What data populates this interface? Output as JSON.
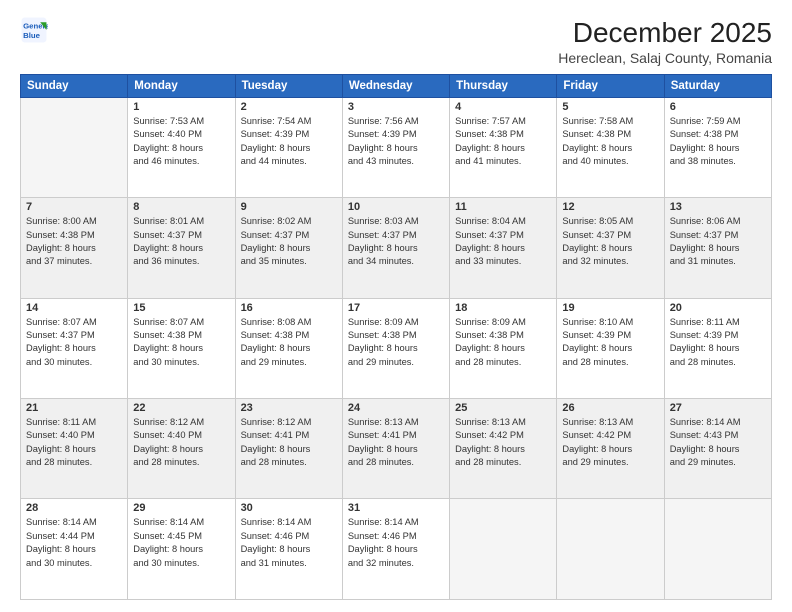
{
  "header": {
    "logo_line1": "General",
    "logo_line2": "Blue",
    "month": "December 2025",
    "location": "Hereclean, Salaj County, Romania"
  },
  "weekdays": [
    "Sunday",
    "Monday",
    "Tuesday",
    "Wednesday",
    "Thursday",
    "Friday",
    "Saturday"
  ],
  "weeks": [
    [
      {
        "day": "",
        "info": ""
      },
      {
        "day": "1",
        "info": "Sunrise: 7:53 AM\nSunset: 4:40 PM\nDaylight: 8 hours\nand 46 minutes."
      },
      {
        "day": "2",
        "info": "Sunrise: 7:54 AM\nSunset: 4:39 PM\nDaylight: 8 hours\nand 44 minutes."
      },
      {
        "day": "3",
        "info": "Sunrise: 7:56 AM\nSunset: 4:39 PM\nDaylight: 8 hours\nand 43 minutes."
      },
      {
        "day": "4",
        "info": "Sunrise: 7:57 AM\nSunset: 4:38 PM\nDaylight: 8 hours\nand 41 minutes."
      },
      {
        "day": "5",
        "info": "Sunrise: 7:58 AM\nSunset: 4:38 PM\nDaylight: 8 hours\nand 40 minutes."
      },
      {
        "day": "6",
        "info": "Sunrise: 7:59 AM\nSunset: 4:38 PM\nDaylight: 8 hours\nand 38 minutes."
      }
    ],
    [
      {
        "day": "7",
        "info": "Sunrise: 8:00 AM\nSunset: 4:38 PM\nDaylight: 8 hours\nand 37 minutes."
      },
      {
        "day": "8",
        "info": "Sunrise: 8:01 AM\nSunset: 4:37 PM\nDaylight: 8 hours\nand 36 minutes."
      },
      {
        "day": "9",
        "info": "Sunrise: 8:02 AM\nSunset: 4:37 PM\nDaylight: 8 hours\nand 35 minutes."
      },
      {
        "day": "10",
        "info": "Sunrise: 8:03 AM\nSunset: 4:37 PM\nDaylight: 8 hours\nand 34 minutes."
      },
      {
        "day": "11",
        "info": "Sunrise: 8:04 AM\nSunset: 4:37 PM\nDaylight: 8 hours\nand 33 minutes."
      },
      {
        "day": "12",
        "info": "Sunrise: 8:05 AM\nSunset: 4:37 PM\nDaylight: 8 hours\nand 32 minutes."
      },
      {
        "day": "13",
        "info": "Sunrise: 8:06 AM\nSunset: 4:37 PM\nDaylight: 8 hours\nand 31 minutes."
      }
    ],
    [
      {
        "day": "14",
        "info": "Sunrise: 8:07 AM\nSunset: 4:37 PM\nDaylight: 8 hours\nand 30 minutes."
      },
      {
        "day": "15",
        "info": "Sunrise: 8:07 AM\nSunset: 4:38 PM\nDaylight: 8 hours\nand 30 minutes."
      },
      {
        "day": "16",
        "info": "Sunrise: 8:08 AM\nSunset: 4:38 PM\nDaylight: 8 hours\nand 29 minutes."
      },
      {
        "day": "17",
        "info": "Sunrise: 8:09 AM\nSunset: 4:38 PM\nDaylight: 8 hours\nand 29 minutes."
      },
      {
        "day": "18",
        "info": "Sunrise: 8:09 AM\nSunset: 4:38 PM\nDaylight: 8 hours\nand 28 minutes."
      },
      {
        "day": "19",
        "info": "Sunrise: 8:10 AM\nSunset: 4:39 PM\nDaylight: 8 hours\nand 28 minutes."
      },
      {
        "day": "20",
        "info": "Sunrise: 8:11 AM\nSunset: 4:39 PM\nDaylight: 8 hours\nand 28 minutes."
      }
    ],
    [
      {
        "day": "21",
        "info": "Sunrise: 8:11 AM\nSunset: 4:40 PM\nDaylight: 8 hours\nand 28 minutes."
      },
      {
        "day": "22",
        "info": "Sunrise: 8:12 AM\nSunset: 4:40 PM\nDaylight: 8 hours\nand 28 minutes."
      },
      {
        "day": "23",
        "info": "Sunrise: 8:12 AM\nSunset: 4:41 PM\nDaylight: 8 hours\nand 28 minutes."
      },
      {
        "day": "24",
        "info": "Sunrise: 8:13 AM\nSunset: 4:41 PM\nDaylight: 8 hours\nand 28 minutes."
      },
      {
        "day": "25",
        "info": "Sunrise: 8:13 AM\nSunset: 4:42 PM\nDaylight: 8 hours\nand 28 minutes."
      },
      {
        "day": "26",
        "info": "Sunrise: 8:13 AM\nSunset: 4:42 PM\nDaylight: 8 hours\nand 29 minutes."
      },
      {
        "day": "27",
        "info": "Sunrise: 8:14 AM\nSunset: 4:43 PM\nDaylight: 8 hours\nand 29 minutes."
      }
    ],
    [
      {
        "day": "28",
        "info": "Sunrise: 8:14 AM\nSunset: 4:44 PM\nDaylight: 8 hours\nand 30 minutes."
      },
      {
        "day": "29",
        "info": "Sunrise: 8:14 AM\nSunset: 4:45 PM\nDaylight: 8 hours\nand 30 minutes."
      },
      {
        "day": "30",
        "info": "Sunrise: 8:14 AM\nSunset: 4:46 PM\nDaylight: 8 hours\nand 31 minutes."
      },
      {
        "day": "31",
        "info": "Sunrise: 8:14 AM\nSunset: 4:46 PM\nDaylight: 8 hours\nand 32 minutes."
      },
      {
        "day": "",
        "info": ""
      },
      {
        "day": "",
        "info": ""
      },
      {
        "day": "",
        "info": ""
      }
    ]
  ]
}
